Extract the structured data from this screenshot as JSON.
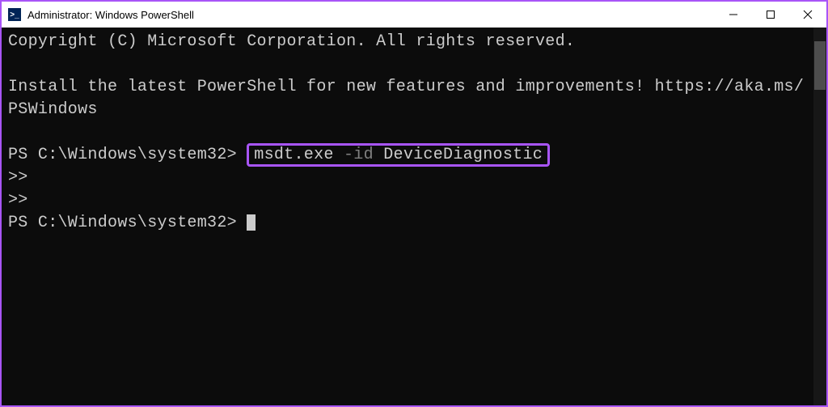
{
  "window": {
    "title": "Administrator: Windows PowerShell",
    "icon_label": ">_"
  },
  "terminal": {
    "copyright": "Copyright (C) Microsoft Corporation. All rights reserved.",
    "install_msg": "Install the latest PowerShell for new features and improvements! https://aka.ms/PSWindows",
    "prompt1": "PS C:\\Windows\\system32>",
    "command_exe": "msdt.exe",
    "command_flag": "-id",
    "command_arg": "DeviceDiagnostic",
    "continuation": ">>",
    "prompt2": "PS C:\\Windows\\system32>"
  }
}
